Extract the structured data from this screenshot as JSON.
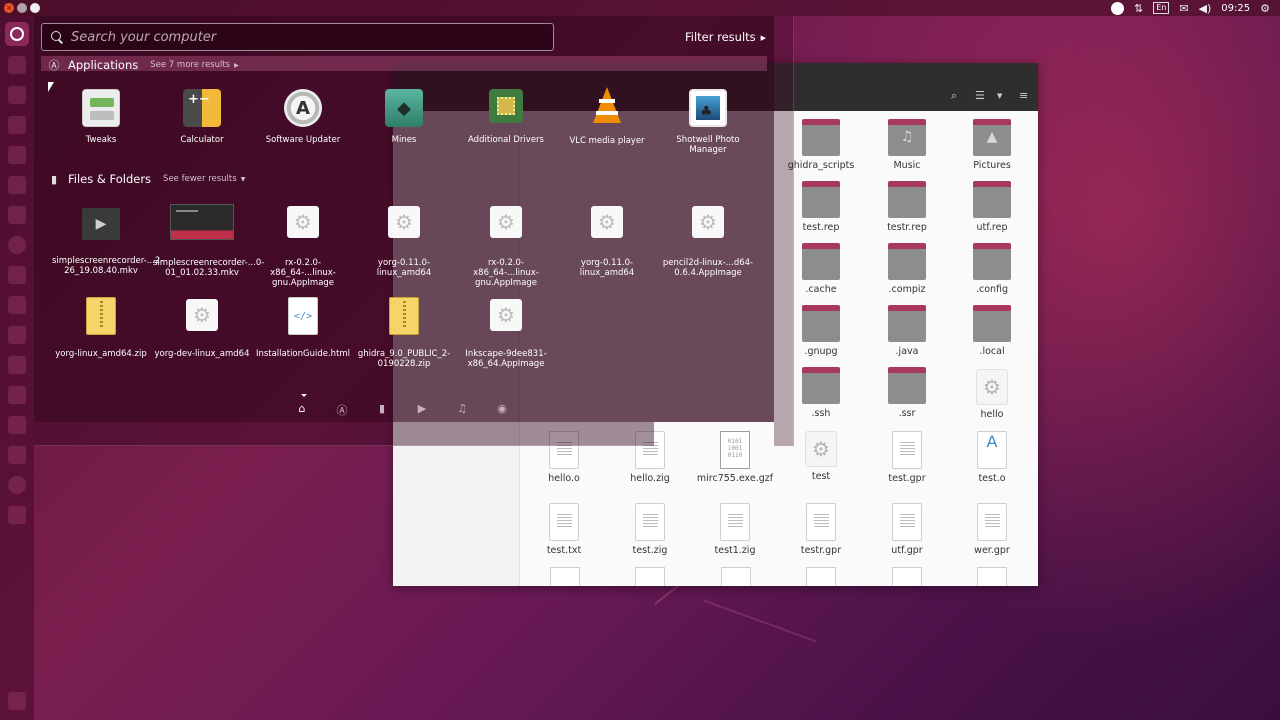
{
  "top_panel": {
    "language": "En",
    "clock": "09:25"
  },
  "dash": {
    "search_placeholder": "Search your computer",
    "filter_results": "Filter results",
    "applications": {
      "title": "Applications",
      "more": "See 7 more results",
      "items": [
        {
          "label": "Tweaks",
          "icon": "tweaks-icon"
        },
        {
          "label": "Calculator",
          "icon": "calculator-icon"
        },
        {
          "label": "Software Updater",
          "icon": "software-updater-icon"
        },
        {
          "label": "Mines",
          "icon": "mines-icon"
        },
        {
          "label": "Additional Drivers",
          "icon": "additional-drivers-icon"
        },
        {
          "label": "VLC media player",
          "icon": "vlc-icon"
        },
        {
          "label": "Shotwell Photo Manager",
          "icon": "shotwell-icon"
        }
      ]
    },
    "files": {
      "title": "Files & Folders",
      "fewer": "See fewer results",
      "items": [
        {
          "label": "simplescreenrecorder-...2-26_19.08.40.mkv",
          "icon": "video-file-icon"
        },
        {
          "label": "simplescreenrecorder-...0-01_01.02.33.mkv",
          "icon": "video-thumbnail-icon"
        },
        {
          "label": "rx-0.2.0-x86_64-...linux-gnu.AppImage",
          "icon": "appimage-icon"
        },
        {
          "label": "yorg-0.11.0-linux_amd64",
          "icon": "executable-icon"
        },
        {
          "label": "rx-0.2.0-x86_64-...linux-gnu.AppImage",
          "icon": "appimage-icon"
        },
        {
          "label": "yorg-0.11.0-linux_amd64",
          "icon": "executable-icon"
        },
        {
          "label": "pencil2d-linux-...d64-0.6.4.AppImage",
          "icon": "appimage-icon"
        },
        {
          "label": "yorg-linux_amd64.zip",
          "icon": "zip-icon"
        },
        {
          "label": "yorg-dev-linux_amd64",
          "icon": "executable-icon"
        },
        {
          "label": "InstallationGuide.html",
          "icon": "html-file-icon"
        },
        {
          "label": "ghidra_9.0_PUBLIC_2-0190228.zip",
          "icon": "zip-icon"
        },
        {
          "label": "Inkscape-9dee831-x86_64.AppImage",
          "icon": "appimage-icon"
        }
      ]
    },
    "nav": [
      "home-icon",
      "applications-icon",
      "files-icon",
      "video-icon",
      "music-icon",
      "photos-icon"
    ]
  },
  "files_window": {
    "items": [
      {
        "label": "ghidra_scripts",
        "type": "folder"
      },
      {
        "label": "Music",
        "type": "folder"
      },
      {
        "label": "Pictures",
        "type": "folder"
      },
      {
        "label": "test.rep",
        "type": "folder"
      },
      {
        "label": "testr.rep",
        "type": "folder"
      },
      {
        "label": "utf.rep",
        "type": "folder"
      },
      {
        "label": ".cache",
        "type": "folder"
      },
      {
        "label": ".compiz",
        "type": "folder"
      },
      {
        "label": ".config",
        "type": "folder"
      },
      {
        "label": ".gnupg",
        "type": "folder"
      },
      {
        "label": ".java",
        "type": "folder"
      },
      {
        "label": ".local",
        "type": "folder"
      },
      {
        "label": ".ssh",
        "type": "folder"
      },
      {
        "label": ".ssr",
        "type": "folder"
      },
      {
        "label": "hello",
        "type": "executable"
      },
      {
        "label": "hello.o",
        "type": "text"
      },
      {
        "label": "hello.zig",
        "type": "text"
      },
      {
        "label": "mirc755.exe.gzf",
        "type": "binary"
      },
      {
        "label": "test",
        "type": "executable"
      },
      {
        "label": "test.gpr",
        "type": "text"
      },
      {
        "label": "test.o",
        "type": "text"
      },
      {
        "label": "test.txt",
        "type": "text"
      },
      {
        "label": "test.zig",
        "type": "text"
      },
      {
        "label": "test1.zig",
        "type": "text"
      },
      {
        "label": "testr.gpr",
        "type": "text"
      },
      {
        "label": "utf.gpr",
        "type": "text"
      },
      {
        "label": "wer.gpr",
        "type": "text"
      }
    ]
  }
}
